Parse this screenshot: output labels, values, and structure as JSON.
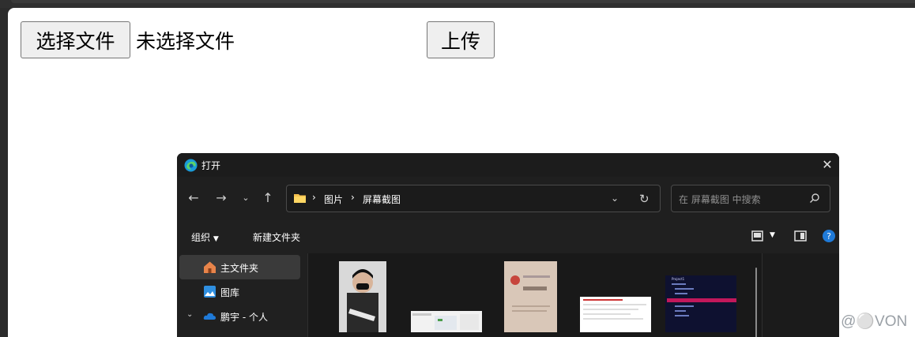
{
  "page": {
    "choose_file_label": "选择文件",
    "file_status": "未选择文件",
    "upload_label": "上传",
    "watermark": "CSDN @⚪VON"
  },
  "dialog": {
    "title": "打开",
    "breadcrumb": [
      "图片",
      "屏幕截图"
    ],
    "search_placeholder": "在 屏幕截图 中搜索",
    "commands": {
      "organize": "组织",
      "new_folder": "新建文件夹"
    },
    "nav_items": [
      {
        "label": "主文件夹",
        "icon": "home-icon",
        "selected": true
      },
      {
        "label": "图库",
        "icon": "gallery-icon",
        "selected": false
      },
      {
        "label": "鹏宇 - 个人",
        "icon": "onedrive-icon",
        "selected": false
      }
    ],
    "thumb_text": "Project1"
  },
  "colors": {
    "dialog_bg": "#191919",
    "accent": "#1f7ad8",
    "page_bg": "#ffffff"
  }
}
